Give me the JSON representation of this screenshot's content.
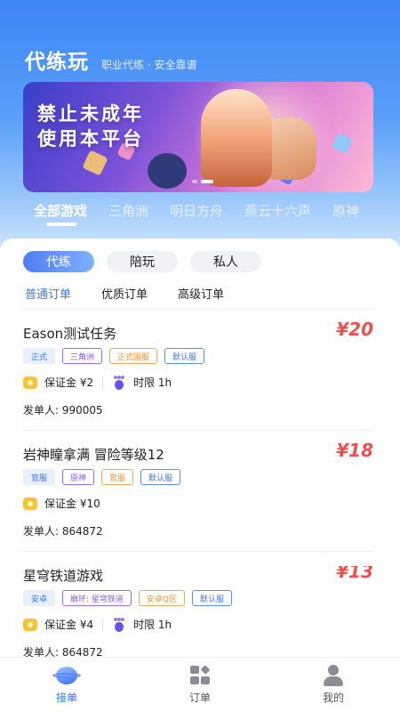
{
  "header": {
    "title": "代练玩",
    "slogan": "职业代练 · 安全靠谱"
  },
  "banner": {
    "text_line1": "禁止未成年",
    "text_line2": "使用本平台"
  },
  "game_tabs": [
    {
      "label": "全部游戏",
      "active": true
    },
    {
      "label": "三角洲",
      "active": false
    },
    {
      "label": "明日方舟",
      "active": false
    },
    {
      "label": "燕云十六声",
      "active": false
    },
    {
      "label": "原神",
      "active": false
    }
  ],
  "order_type_tabs": [
    {
      "label": "代练",
      "active": true
    },
    {
      "label": "陪玩",
      "active": false
    },
    {
      "label": "私人",
      "active": false
    }
  ],
  "level_tabs": [
    {
      "label": "普通订单",
      "active": true
    },
    {
      "label": "优质订单",
      "active": false
    },
    {
      "label": "高级订单",
      "active": false
    }
  ],
  "orders": [
    {
      "title": "Eason测试任务",
      "price": "¥20",
      "tags": [
        {
          "text": "正式",
          "style": "blue-fill"
        },
        {
          "text": "三角洲",
          "style": "purple"
        },
        {
          "text": "正式国服",
          "style": "orange"
        },
        {
          "text": "默认服",
          "style": "blue"
        }
      ],
      "deposit": "保证金 ¥2",
      "time_limit": "时限 1h",
      "publisher": "发单人: 990005"
    },
    {
      "title": "岩神瞳拿满 冒险等级12",
      "price": "¥18",
      "tags": [
        {
          "text": "官服",
          "style": "blue-fill"
        },
        {
          "text": "原神",
          "style": "purple"
        },
        {
          "text": "官服",
          "style": "orange"
        },
        {
          "text": "默认服",
          "style": "blue"
        }
      ],
      "deposit": "保证金 ¥10",
      "time_limit": "",
      "publisher": "发单人: 864872"
    },
    {
      "title": "星穹铁道游戏",
      "price": "¥13",
      "tags": [
        {
          "text": "安卓",
          "style": "blue-fill"
        },
        {
          "text": "崩坏: 星穹铁道",
          "style": "purple"
        },
        {
          "text": "安卓Q区",
          "style": "orange"
        },
        {
          "text": "默认服",
          "style": "blue"
        }
      ],
      "deposit": "保证金 ¥4",
      "time_limit": "时限 1h",
      "publisher": "发单人: 864872"
    }
  ],
  "bottom_nav": [
    {
      "label": "接单",
      "icon": "planet-icon",
      "active": true
    },
    {
      "label": "订单",
      "icon": "grid-icon",
      "active": false
    },
    {
      "label": "我的",
      "icon": "person-icon",
      "active": false
    }
  ],
  "colors": {
    "accent": "#3b77f0",
    "price": "#f0504c"
  }
}
